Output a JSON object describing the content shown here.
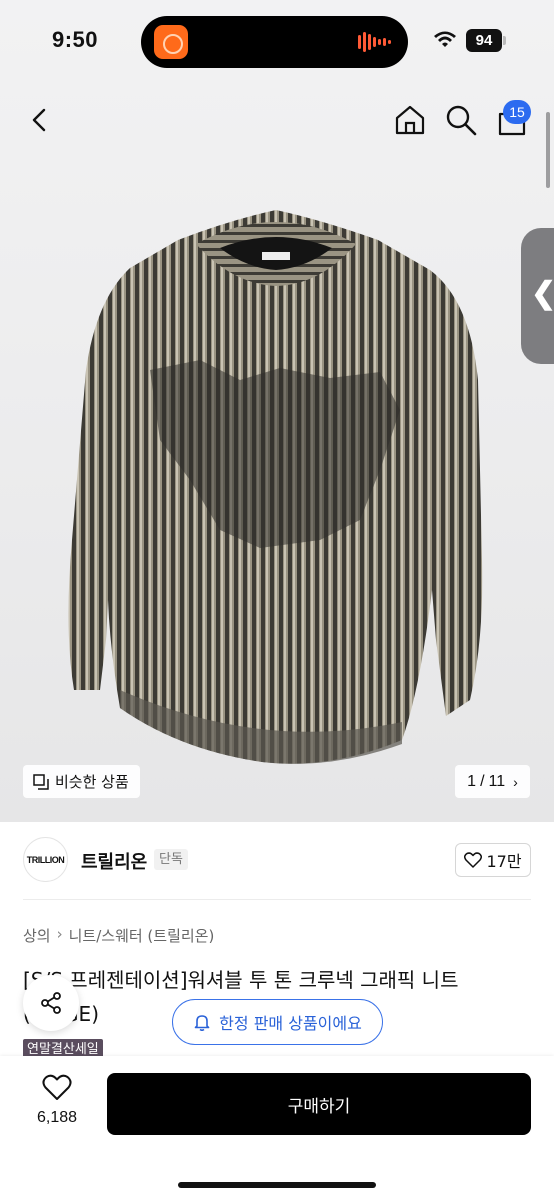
{
  "status_bar": {
    "time": "9:50",
    "battery": "94"
  },
  "top_nav": {
    "cart_count": "15"
  },
  "side_tab": {
    "glyph": "❮"
  },
  "gallery": {
    "similar_label": "비슷한 상품",
    "current_page": "1",
    "total_pages": "11",
    "page_separator": "/"
  },
  "brand": {
    "logo_text": "TRILLION",
    "name": "트릴리온",
    "badge": "단독",
    "likes": "17만"
  },
  "product": {
    "breadcrumb": [
      "상의",
      "니트/스웨터 (트릴리온)"
    ],
    "title": "[S/S 프레젠테이션]워셔블 투 톤 크루넥 그래픽 니트 (BEIGE)",
    "limited_notice": "한정 판매 상품이에요",
    "sale_tag": "연말결산세일"
  },
  "bottom_bar": {
    "wish_count": "6,188",
    "buy_label": "구매하기"
  },
  "colors": {
    "accent_blue": "#2c6bf0",
    "buy_button": "#000000",
    "sale_tag": "#5a4d5e"
  }
}
